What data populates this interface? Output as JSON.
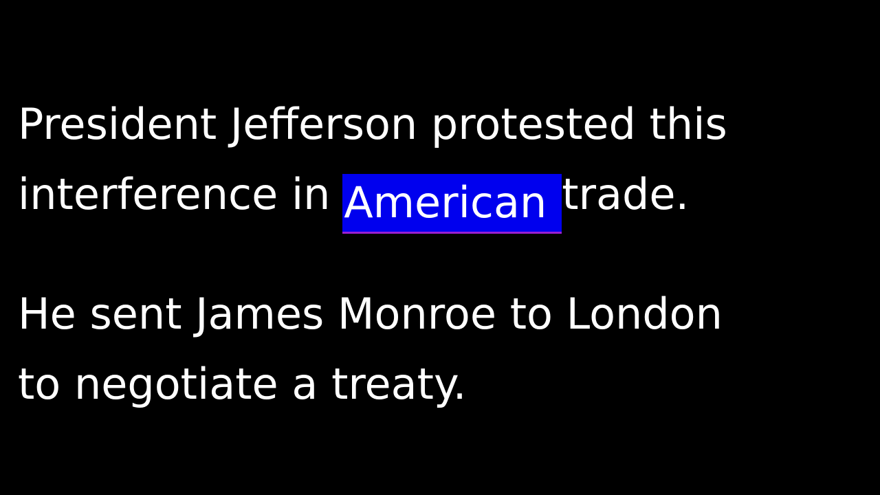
{
  "paragraph1": {
    "line1": "President Jefferson protested this",
    "line2_before": "interference in ",
    "line2_highlight": "American",
    "line2_after": "trade."
  },
  "paragraph2": {
    "line1": "He sent James Monroe to London",
    "line2": "to negotiate a treaty."
  },
  "colors": {
    "background": "#000000",
    "text": "#ffffff",
    "highlight": "#0000ee",
    "highlight_underline": "#9a1fd0"
  }
}
